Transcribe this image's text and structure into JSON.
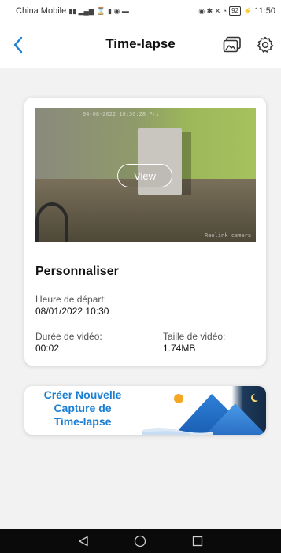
{
  "status_bar": {
    "carrier": "China Mobile",
    "battery": "92",
    "time": "11:50"
  },
  "header": {
    "title": "Time-lapse"
  },
  "video_card": {
    "thumbnail_timestamp": "04-08-2022 10:30:28 Fri",
    "thumbnail_brand": "Reolink camera",
    "view_label": "View",
    "title": "Personnaliser",
    "start_label": "Heure de départ:",
    "start_value": "08/01/2022 10:30",
    "duration_label": "Durée de vidéo:",
    "duration_value": "00:02",
    "size_label": "Taille de vidéo:",
    "size_value": "1.74MB"
  },
  "banner": {
    "line1": "Créer Nouvelle",
    "line2": "Capture de",
    "line3": "Time-lapse"
  },
  "colors": {
    "accent": "#1a7fd4",
    "background": "#f2f2f2",
    "card": "#ffffff"
  },
  "icons": {
    "back": "chevron-left-icon",
    "gallery": "image-gallery-icon",
    "settings": "gear-icon",
    "nav_back": "triangle-back-icon",
    "nav_home": "circle-home-icon",
    "nav_recent": "square-recent-icon"
  }
}
